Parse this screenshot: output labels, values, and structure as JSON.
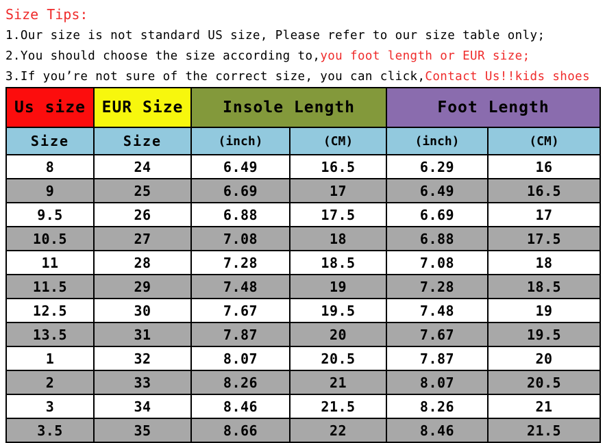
{
  "tips": {
    "title": "Size Tips:",
    "lines": [
      {
        "num": "1.",
        "black": "Our size is not standard US size, Please refer to our size table only;",
        "red": ""
      },
      {
        "num": "2.",
        "black": "You should choose the size according to,",
        "red": "you foot length or EUR size;"
      },
      {
        "num": "3.",
        "black": "If you’re not sure of the correct size, you can click,",
        "red": "Contact Us!!kids shoes"
      }
    ]
  },
  "colors": {
    "tips_red": "#ef2b2b",
    "header_us": "#fc0d0d",
    "header_eur": "#f7f70d",
    "header_insole": "#83993b",
    "header_foot": "#8a6cae",
    "unit_row": "#92c9de",
    "row_odd": "#ffffff",
    "row_even": "#a8a8a8",
    "border": "#000000"
  },
  "table": {
    "group_headers": [
      {
        "label": "Us size",
        "span": 1
      },
      {
        "label": "EUR Size",
        "span": 1
      },
      {
        "label": "Insole Length",
        "span": 2
      },
      {
        "label": "Foot Length",
        "span": 2
      }
    ],
    "unit_headers": [
      "Size",
      "Size",
      "(inch)",
      "(CM)",
      "(inch)",
      "(CM)"
    ],
    "rows": [
      [
        "8",
        "24",
        "6.49",
        "16.5",
        "6.29",
        "16"
      ],
      [
        "9",
        "25",
        "6.69",
        "17",
        "6.49",
        "16.5"
      ],
      [
        "9.5",
        "26",
        "6.88",
        "17.5",
        "6.69",
        "17"
      ],
      [
        "10.5",
        "27",
        "7.08",
        "18",
        "6.88",
        "17.5"
      ],
      [
        "11",
        "28",
        "7.28",
        "18.5",
        "7.08",
        "18"
      ],
      [
        "11.5",
        "29",
        "7.48",
        "19",
        "7.28",
        "18.5"
      ],
      [
        "12.5",
        "30",
        "7.67",
        "19.5",
        "7.48",
        "19"
      ],
      [
        "13.5",
        "31",
        "7.87",
        "20",
        "7.67",
        "19.5"
      ],
      [
        "1",
        "32",
        "8.07",
        "20.5",
        "7.87",
        "20"
      ],
      [
        "2",
        "33",
        "8.26",
        "21",
        "8.07",
        "20.5"
      ],
      [
        "3",
        "34",
        "8.46",
        "21.5",
        "8.26",
        "21"
      ],
      [
        "3.5",
        "35",
        "8.66",
        "22",
        "8.46",
        "21.5"
      ]
    ]
  }
}
